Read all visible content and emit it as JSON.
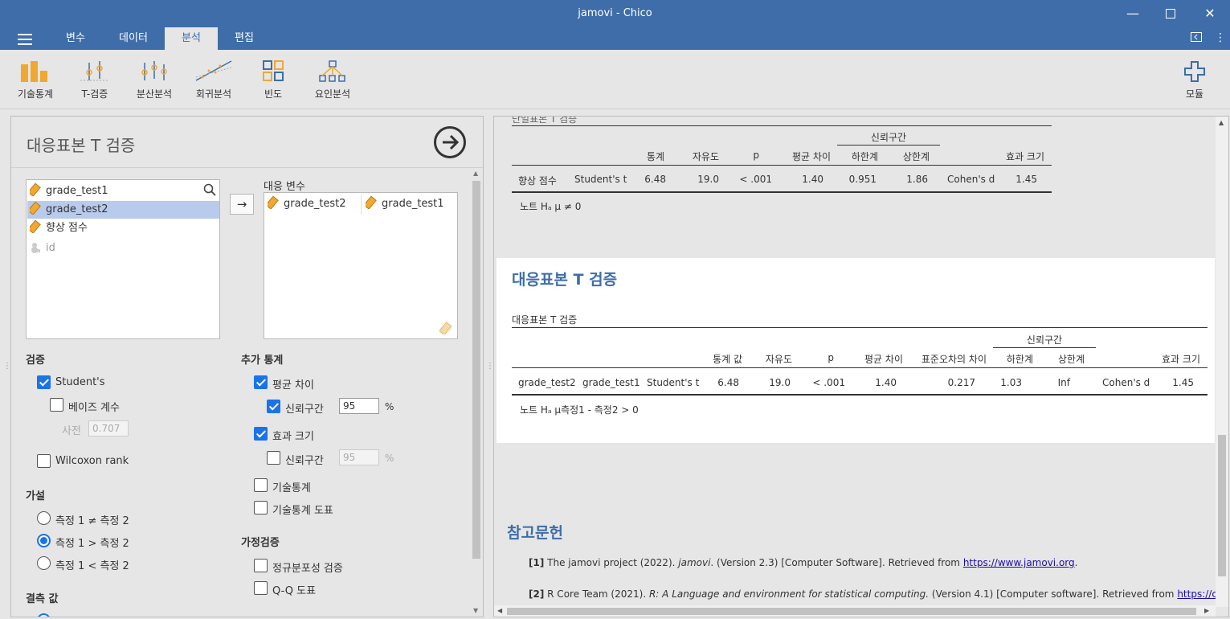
{
  "window": {
    "title": "jamovi - Chico"
  },
  "menu": {
    "tabs": [
      "변수",
      "데이터",
      "분석",
      "편집"
    ],
    "active_tab": "분석"
  },
  "ribbon": {
    "buttons": [
      "기술통계",
      "T-검증",
      "분산분석",
      "회귀분석",
      "빈도",
      "요인분석"
    ],
    "modules_label": "모듈"
  },
  "options": {
    "title": "대응표본 T 검증",
    "variables": [
      "grade_test1",
      "grade_test2",
      "향상 점수",
      "id"
    ],
    "selected_variable": "grade_test2",
    "paired_label": "대응 변수",
    "paired": [
      "grade_test2",
      "grade_test1"
    ],
    "tests": {
      "heading": "검증",
      "student": "Student's",
      "bayes": "베이즈 계수",
      "prior_label": "사전",
      "prior_value": "0.707",
      "wilcoxon": "Wilcoxon rank"
    },
    "hypothesis": {
      "heading": "가설",
      "opt1": "측정 1 ≠ 측정 2",
      "opt2": "측정 1 > 측정 2",
      "opt3": "측정 1 < 측정 2"
    },
    "missing": {
      "heading": "결측 값"
    },
    "additional": {
      "heading": "추가 통계",
      "mean_diff": "평균 차이",
      "ci": "신뢰구간",
      "ci_value": "95",
      "pct": "%",
      "effect_size": "효과 크기",
      "ci2": "신뢰구간",
      "ci2_value": "95",
      "descriptives": "기술통계",
      "desc_plot": "기술통계 도표"
    },
    "assumptions": {
      "heading": "가정검증",
      "normality": "정규분포성 검증",
      "qq": "Q-Q 도표"
    }
  },
  "results": {
    "table1": {
      "cut_title": "단일표본 T 검증",
      "ci_header": "신뢰구간",
      "headers": [
        "통계",
        "자유도",
        "p",
        "평균 차이",
        "하한계",
        "상한계",
        "효과 크기"
      ],
      "row": [
        "향상 점수",
        "Student's t",
        "6.48",
        "19.0",
        "< .001",
        "1.40",
        "0.951",
        "1.86",
        "Cohen's d",
        "1.45"
      ],
      "note": "노트 Hₐ μ ≠ 0"
    },
    "section_title": "대응표본 T 검증",
    "table2": {
      "title": "대응표본 T 검증",
      "ci_header": "신뢰구간",
      "headers": [
        "통계 값",
        "자유도",
        "p",
        "평균 차이",
        "표준오차의 차이",
        "하한계",
        "상한계",
        "효과 크기"
      ],
      "row": [
        "grade_test2",
        "grade_test1",
        "Student's t",
        "6.48",
        "19.0",
        "< .001",
        "1.40",
        "0.217",
        "1.03",
        "Inf",
        "Cohen's d",
        "1.45"
      ],
      "note": "노트 Hₐ μ측정1 - 측정2 > 0"
    },
    "references": {
      "title": "참고문헌",
      "ref1_num": "[1]",
      "ref1_a": "The jamovi project (2022). ",
      "ref1_b": "jamovi",
      "ref1_c": ". (Version 2.3) [Computer Software]. Retrieved from ",
      "ref1_link": "https://www.jamovi.org",
      "ref1_d": ".",
      "ref2_num": "[2]",
      "ref2_a": "R Core Team (2021). ",
      "ref2_b": "R: A Language and environment for statistical computing.",
      "ref2_c": " (Version 4.1) [Computer software]. Retrieved from ",
      "ref2_link": "https://cran.r-"
    }
  },
  "colors": {
    "brand": "#3e6da9",
    "accent": "#1a73e8",
    "selection": "#b8cbed"
  }
}
